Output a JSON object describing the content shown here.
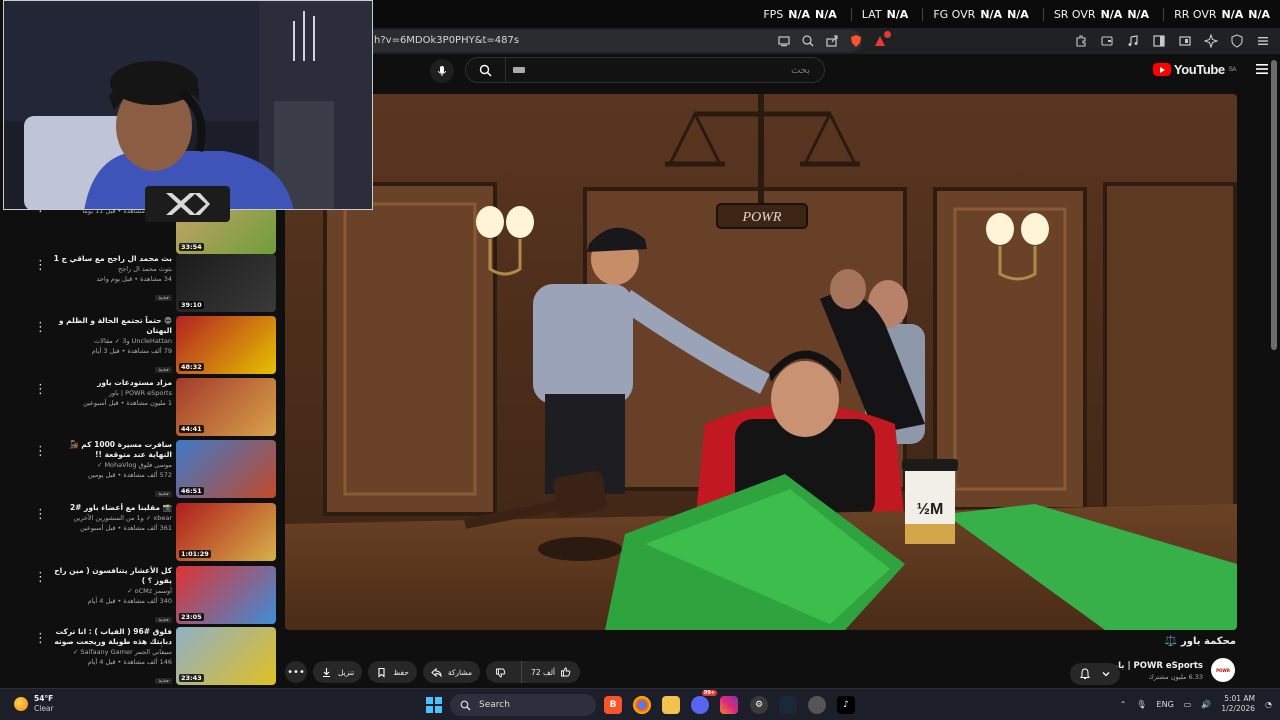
{
  "perf": {
    "fps_label": "FPS",
    "fps_v1": "N/A",
    "fps_v2": "N/A",
    "lat_label": "LAT",
    "lat_v": "N/A",
    "fg_label": "FG OVR",
    "fg_v1": "N/A",
    "fg_v2": "N/A",
    "sr_label": "SR OVR",
    "sr_v1": "N/A",
    "sr_v2": "N/A",
    "rr_label": "RR OVR",
    "rr_v1": "N/A",
    "rr_v2": "N/A"
  },
  "browser": {
    "url": "h?v=6MDOk3P0PHY&t=487s",
    "notif_count": "1"
  },
  "masthead": {
    "search_placeholder": "بحث",
    "logo_text": "YouTube",
    "region": "SA"
  },
  "webcam": {
    "logo_text": "XBX"
  },
  "recommendations": [
    {
      "title": "",
      "channel": "Fresh Fr ✓ و3 من المنشورين الآخرين",
      "views": "789 ألف مشاهدة • قبل 11 يومًا",
      "duration": "33:54",
      "colors": [
        "#c9a36a",
        "#6f9e3a"
      ]
    },
    {
      "title": "بث محمد ال راجح مع ساقي ج 1",
      "channel": "بثوث محمد ال راجح",
      "views": "34 مشاهدة • قبل يوم واحد",
      "new": "جديد",
      "duration": "39:10",
      "colors": [
        "#1b1b1b",
        "#3a3a3a"
      ]
    },
    {
      "title": "😡 حتماً تجتمع الحالة و الظلم و البهتان",
      "channel": "UncleHattan و3 ✓ مقالات",
      "views": "79 ألف مشاهدة • قبل 3 أيام",
      "new": "جديد",
      "duration": "48:32",
      "colors": [
        "#b22222",
        "#e6c200"
      ]
    },
    {
      "title": "مزاد مستودعات باور",
      "channel": "POWR eSports | باور",
      "views": "1 مليون مشاهدة • قبل أسبوعين",
      "duration": "44:41",
      "colors": [
        "#a33a2a",
        "#d9a24a"
      ]
    },
    {
      "title": "سافرت مسيرة 1000 كم 🚂 النهاية عند متوقعة !!",
      "channel": "موسى فلوق MohaVlog ✓",
      "views": "572 ألف مشاهدة • قبل يومين",
      "new": "جديد",
      "duration": "46:51",
      "colors": [
        "#3d79c9",
        "#c24a2a"
      ]
    },
    {
      "title": "📸 مقلبنا مع أعضاء باور #2",
      "channel": "xbear ✓ و1 من المنشورين الآخرين",
      "views": "361 ألف مشاهدة • قبل أسبوعين",
      "duration": "1:01:29",
      "colors": [
        "#b01c1c",
        "#d6b24a"
      ]
    },
    {
      "title": "كل الأعشار يتنافسون ( مين راح يفوز ؟ )",
      "channel": "أوسمز oCMz ✓",
      "views": "340 ألف مشاهدة • قبل 4 أيام",
      "new": "جديد",
      "duration": "23:05",
      "colors": [
        "#d33",
        "#3e8ed8"
      ]
    },
    {
      "title": "فلوق #96 ( الفياب ) : انا تركت دبابتك هذه طويلة وريجعت صوته + أول طلعة بالاسكاني",
      "channel": "سيفاني الجمر Saifaany Gamer ✓",
      "views": "146 ألف مشاهدة • قبل 4 أيام",
      "new": "جديد",
      "duration": "23:43",
      "colors": [
        "#8fb0c8",
        "#e0c020"
      ]
    }
  ],
  "video": {
    "title": "محكمة باور",
    "title_emoji": "⚖️",
    "channel_name": "POWR eSports | باور",
    "subscribers": "6.33 مليون مشترك",
    "likes": "72 ألف",
    "share_label": "مشاركة",
    "save_label": "حفظ",
    "download_label": "تنزيل",
    "mug_text": "½M",
    "sign_text": "POWR"
  },
  "taskbar": {
    "temperature": "54°F",
    "condition": "Clear",
    "search_label": "Search",
    "language": "ENG",
    "time": "5:01 AM",
    "date": "1/2/2026",
    "discord_badge": "99+"
  }
}
